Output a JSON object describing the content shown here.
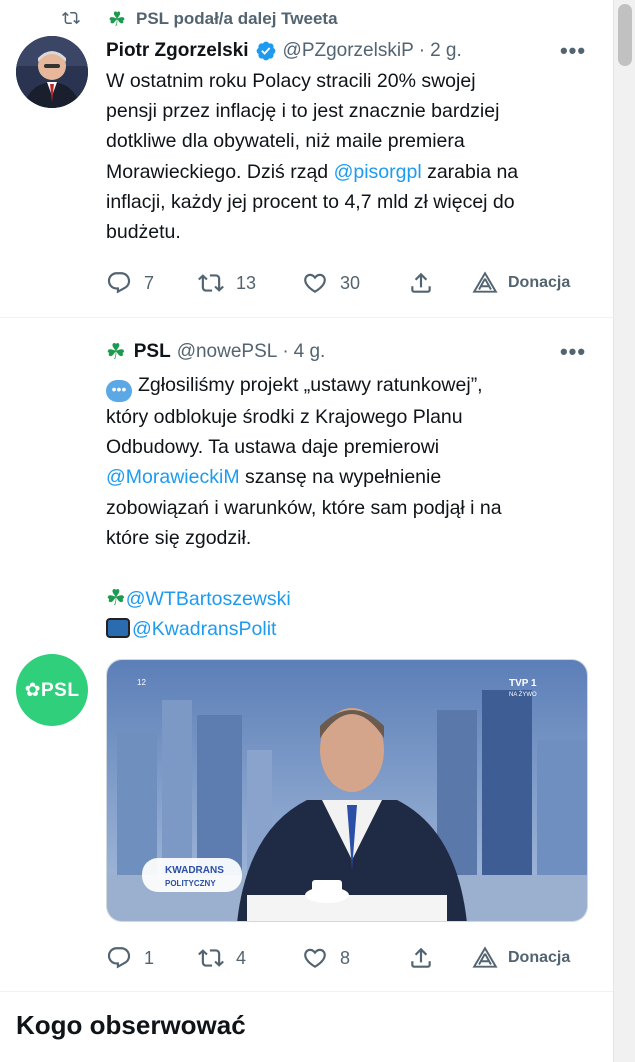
{
  "retweet_banner": {
    "text": "PSL podał/a dalej Tweeta",
    "icon": "clover-icon"
  },
  "tweet1": {
    "name": "Piotr Zgorzelski",
    "handle": "@PZgorzelskiP",
    "separator": "·",
    "time": "2 g.",
    "more": "•••",
    "lines": [
      "W ostatnim roku Polacy stracili 20% swojej",
      "pensji przez inflację i to jest znacznie bardziej",
      "dotkliwe dla obywateli, niż maile premiera",
      "Morawieckiego. Dziś rząd ",
      "@pisorgpl",
      " zarabia na",
      "inflacji, każdy jej procent to 4,7 mld zł więcej do",
      "budżetu."
    ],
    "actions": {
      "replies": "7",
      "retweets": "13",
      "likes": "30",
      "donate": "Donacja"
    }
  },
  "tweet2": {
    "name": "PSL",
    "handle": "@nowePSL",
    "separator": "·",
    "time": "4 g.",
    "more": "•••",
    "avatar_text": "PSL",
    "lines": [
      "Zgłosiliśmy projekt „ustawy ratunkowej”,",
      "który odblokuje środki z Krajowego Planu",
      "Odbudowy. Ta ustawa daje premierowi",
      "@MorawieckiM",
      " szansę na wypełnienie",
      "zobowiązań i warunków, które sam podjął i na",
      "które się zgodził.",
      "@WTBartoszewski",
      "@KwadransPolit"
    ],
    "media": {
      "logo_line1": "KWADRANS",
      "logo_line2": "POLITYCZNY",
      "channel": "TVP 1",
      "channel_sub": "NA ŻYWO",
      "age": "12"
    },
    "actions": {
      "replies": "1",
      "retweets": "4",
      "likes": "8",
      "donate": "Donacja"
    }
  },
  "who_to_follow": {
    "title": "Kogo obserwować"
  },
  "colors": {
    "accent": "#1d9bf0",
    "psl_green": "#2fcf7c",
    "muted": "#536471"
  }
}
